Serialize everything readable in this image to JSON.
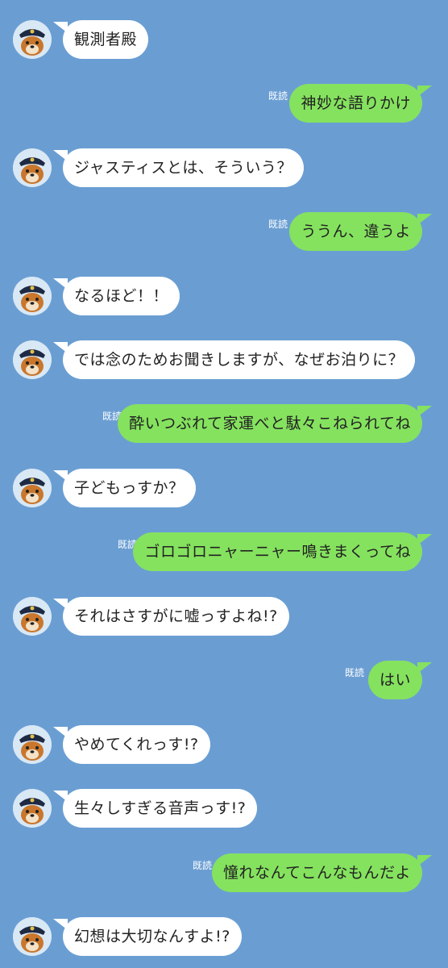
{
  "chat": {
    "read_label": "既読",
    "messages": [
      {
        "side": "in",
        "text": "観測者殿"
      },
      {
        "side": "out",
        "text": "神妙な語りかけ"
      },
      {
        "side": "in",
        "text": "ジャスティスとは、そういう？"
      },
      {
        "side": "out",
        "text": "ううん、違うよ"
      },
      {
        "side": "in",
        "text": "なるほど！！"
      },
      {
        "side": "in",
        "text": "では念のためお聞きしますが、なぜお泊りに？"
      },
      {
        "side": "out",
        "text": "酔いつぶれて家運べと駄々こねられてね"
      },
      {
        "side": "in",
        "text": "子どもっすか？"
      },
      {
        "side": "out",
        "text": "ゴロゴロニャーニャー鳴きまくってね"
      },
      {
        "side": "in",
        "text": "それはさすがに嘘っすよね!?"
      },
      {
        "side": "out",
        "text": "はい"
      },
      {
        "side": "in",
        "text": "やめてくれっす!?"
      },
      {
        "side": "in",
        "text": "生々しすぎる音声っす!?"
      },
      {
        "side": "out",
        "text": "憧れなんてこんなもんだよ"
      },
      {
        "side": "in",
        "text": "幻想は大切なんすよ!?"
      }
    ]
  },
  "colors": {
    "background": "#6A9ED3",
    "incoming_bubble": "#FFFFFF",
    "outgoing_bubble": "#85E25F"
  },
  "avatar_icon": "tanuki-police-avatar-icon"
}
